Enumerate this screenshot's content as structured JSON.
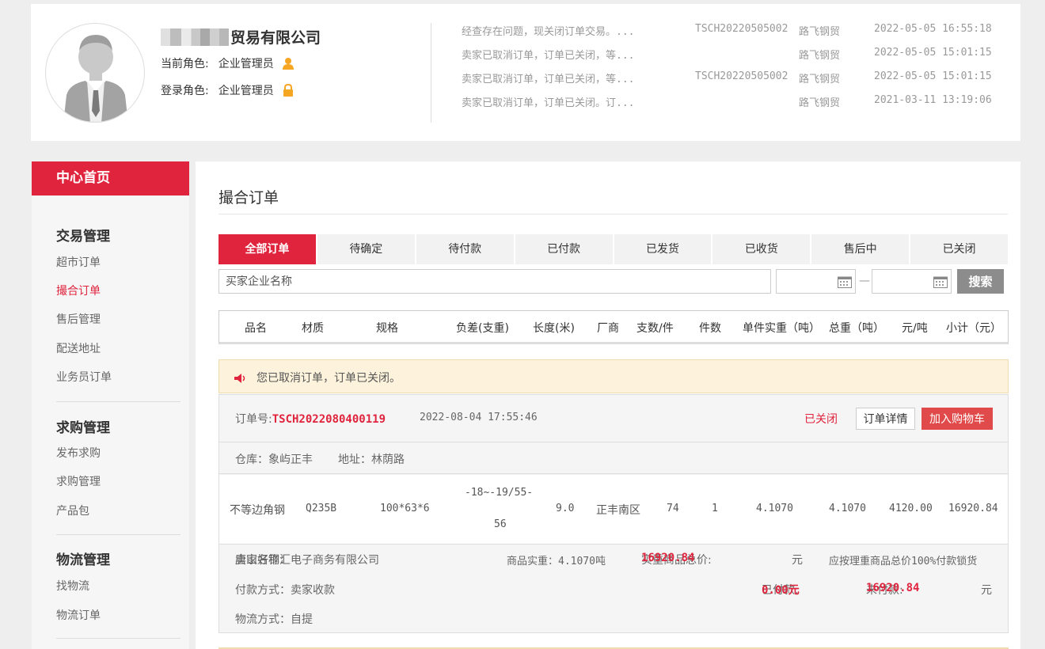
{
  "colors": {
    "accent": "#e0243d",
    "alert_bg": "#fdf3dc",
    "search_btn": "#8c8c8c"
  },
  "header": {
    "company_visible": "贸易有限公司",
    "current_role_label": "当前角色:",
    "current_role_value": "企业管理员",
    "login_role_label": "登录角色:",
    "login_role_value": "企业管理员",
    "notices": [
      {
        "message": "经查存在问题，现关闭订单交易。...",
        "code": "TSCH20220505002",
        "firm": "路飞钢贸",
        "time": "2022-05-05 16:55:18"
      },
      {
        "message": "卖家已取消订单，订单已关闭，等...",
        "code": "",
        "firm": "路飞钢贸",
        "time": "2022-05-05 15:01:15"
      },
      {
        "message": "卖家已取消订单，订单已关闭，等...",
        "code": "TSCH20220505002",
        "firm": "路飞钢贸",
        "time": "2022-05-05 15:01:15"
      },
      {
        "message": "卖家已取消订单，订单已关闭。订...",
        "code": "",
        "firm": "路飞钢贸",
        "time": "2021-03-11 13:19:06"
      }
    ]
  },
  "sidebar": {
    "home": "中心首页",
    "groups": [
      {
        "title": "交易管理",
        "items": [
          "超市订单",
          "撮合订单",
          "售后管理",
          "配送地址",
          "业务员订单"
        ]
      },
      {
        "title": "求购管理",
        "items": [
          "发布求购",
          "求购管理",
          "产品包"
        ]
      },
      {
        "title": "物流管理",
        "items": [
          "找物流",
          "物流订单"
        ]
      }
    ]
  },
  "main": {
    "title": "撮合订单",
    "tabs": [
      "全部订单",
      "待确定",
      "待付款",
      "已付款",
      "已发货",
      "已收货",
      "售后中",
      "已关闭"
    ],
    "search_placeholder": "买家企业名称",
    "search_button": "搜索",
    "columns": [
      "品名",
      "材质",
      "规格",
      "负差(支重)",
      "长度(米)",
      "厂商",
      "支数/件",
      "件数",
      "单件实重（吨）",
      "总重（吨）",
      "元/吨",
      "小计（元）"
    ],
    "alert": "您已取消订单，订单已关闭。",
    "order": {
      "order_no_label": "订单号:",
      "order_no": "TSCH2022080400119",
      "time": "2022-08-04 17:55:46",
      "status": "已关闭",
      "detail_button": "订单详情",
      "cart_button": "加入购物车",
      "warehouse": "仓库：象屿正丰",
      "address": "地址：林荫路",
      "product": {
        "name": "不等边角钢",
        "material": "Q235B",
        "spec": "100*63*6",
        "tolerance_line1": "-18~-19/55-",
        "tolerance_line2": "56",
        "length": "9.0",
        "maker": "正丰南区",
        "pcs_per_bundle": "74",
        "bundles": "1",
        "unit_weight": "4.1070",
        "total_weight": "4.1070",
        "price": "4120.00",
        "subtotal": "16920.84"
      },
      "seller_label": "卖家名称：",
      "seller": "唐山好钢汇电子商务有限公司",
      "net_weight": "商品实重：4.1070吨",
      "total_label": "实重商品总价:",
      "total_value": "16920.84",
      "unit_yuan": "元",
      "lock_note": "应按理重商品总价100%付款锁货",
      "payment_method": "付款方式：卖家收款",
      "paid_label": "已付款:",
      "paid_value": "0.00元",
      "unpaid_label": "未付款:",
      "unpaid_value": "16920.84",
      "logistics": "物流方式：自提"
    }
  }
}
